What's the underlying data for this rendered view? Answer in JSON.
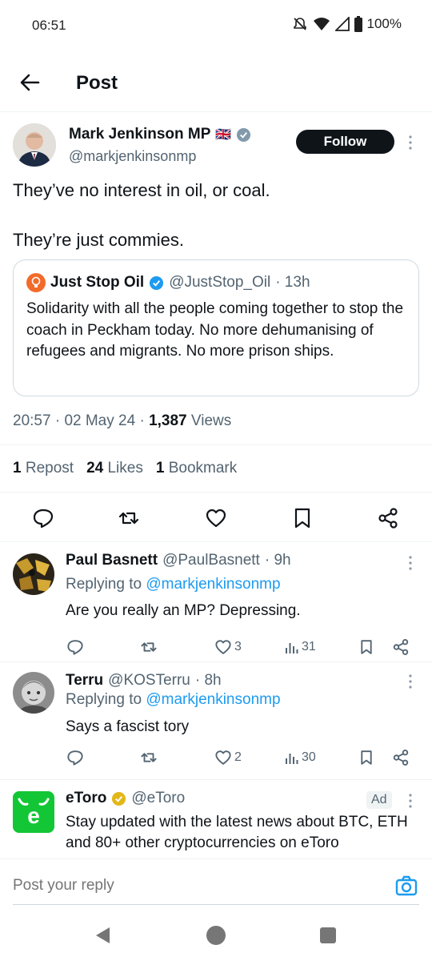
{
  "status": {
    "time": "06:51",
    "battery": "100%"
  },
  "header": {
    "title": "Post"
  },
  "post": {
    "author_name": "Mark Jenkinson MP",
    "author_flag": "🇬🇧",
    "author_handle": "@markjenkinsonmp",
    "follow_label": "Follow",
    "text": "They’ve no interest in oil, or coal.\n\nThey’re just commies.",
    "quote": {
      "name": "Just Stop Oil",
      "handle": "@JustStop_Oil",
      "time": "· 13h",
      "text": "Solidarity with all the people coming together to stop the coach in Peckham today. No more dehumanising of refugees and migrants. No more prison ships."
    },
    "meta": {
      "time": "20:57",
      "sep1": "·",
      "date": "02 May 24",
      "sep2": "·",
      "views": "1,387",
      "views_label": "Views"
    },
    "stats": {
      "reposts": "1",
      "reposts_label": "Repost",
      "likes": "24",
      "likes_label": "Likes",
      "bookmarks": "1",
      "bookmarks_label": "Bookmark"
    }
  },
  "replies": [
    {
      "name": "Paul Basnett",
      "handle": "@PaulBasnett",
      "time": "· 9h",
      "replying_prefix": "Replying to",
      "replying_to": "@markjenkinsonmp",
      "text": "Are you really an MP? Depressing.",
      "likes": "3",
      "views": "31"
    },
    {
      "name": "Terru",
      "handle": "@KOSTerru",
      "time": "· 8h",
      "replying_prefix": "Replying to",
      "replying_to": "@markjenkinsonmp",
      "text": "Says a fascist tory",
      "likes": "2",
      "views": "30"
    }
  ],
  "ad": {
    "name": "eToro",
    "handle": "@eToro",
    "badge": "Ad",
    "text": "Stay updated with the latest news about BTC, ETH and 80+ other cryptocurrencies on eToro"
  },
  "reply_bar": {
    "placeholder": "Post your reply"
  },
  "colors": {
    "accent": "#1d9bf0",
    "text": "#0f1419",
    "muted": "#536471",
    "etoro": "#13c636"
  }
}
